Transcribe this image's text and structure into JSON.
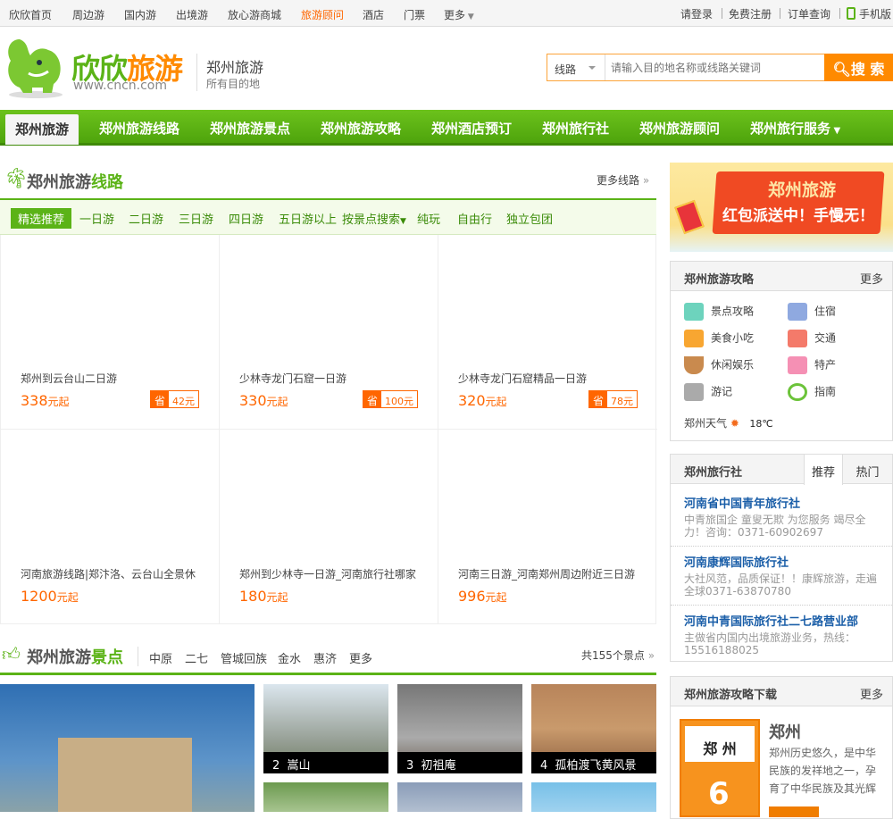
{
  "topbar": {
    "links": [
      "欣欣首页",
      "周边游",
      "国内游",
      "出境游",
      "放心游商城",
      "旅游顾问",
      "酒店",
      "门票",
      "更多"
    ],
    "active_color": "#ff6600",
    "right": [
      "请登录",
      "免费注册",
      "订单查询",
      "手机版"
    ]
  },
  "header": {
    "brand_a": "欣欣",
    "brand_b": "旅游",
    "domain": "www.cncn.com",
    "city": "郑州旅游",
    "slogan": "所有目的地"
  },
  "search": {
    "type": "线路",
    "placeholder": "请输入目的地名称或线路关键词",
    "button": "搜 索"
  },
  "nav": {
    "items": [
      "郑州旅游",
      "郑州旅游线路",
      "郑州旅游景点",
      "郑州旅游攻略",
      "郑州酒店预订",
      "郑州旅行社",
      "郑州旅游顾问",
      "郑州旅行服务"
    ],
    "accent": "#5bb317"
  },
  "routes": {
    "title_a": "郑州旅游",
    "title_b": "线路",
    "more": "更多线路",
    "tabs": [
      "精选推荐",
      "一日游",
      "二日游",
      "三日游",
      "四日游",
      "五日游以上",
      "按景点搜索",
      "纯玩",
      "自由行",
      "独立包团"
    ],
    "items": [
      {
        "title": "郑州到云台山二日游",
        "price": "338",
        "unit": "元起",
        "save_label": "省",
        "save": "42元"
      },
      {
        "title": "少林寺龙门石窟一日游",
        "price": "330",
        "unit": "元起",
        "save_label": "省",
        "save": "100元"
      },
      {
        "title": "少林寺龙门石窟精品一日游",
        "price": "320",
        "unit": "元起",
        "save_label": "省",
        "save": "78元"
      },
      {
        "title": "河南旅游线路|郑汴洛、云台山全景休",
        "price": "1200",
        "unit": "元起"
      },
      {
        "title": "郑州到少林寺一日游_河南旅行社哪家",
        "price": "180",
        "unit": "元起"
      },
      {
        "title": "河南三日游_河南郑州周边附近三日游",
        "price": "996",
        "unit": "元起"
      }
    ]
  },
  "spots": {
    "title_a": "郑州旅游",
    "title_b": "景点",
    "links": [
      "中原",
      "二七",
      "管城回族",
      "金水",
      "惠济",
      "更多"
    ],
    "count": "共155个景点",
    "items": [
      {
        "rank": "2",
        "name": "嵩山"
      },
      {
        "rank": "3",
        "name": "初祖庵"
      },
      {
        "rank": "4",
        "name": "孤柏渡飞黄风景区"
      }
    ]
  },
  "banner": {
    "title": "郑州旅游",
    "text": "红包派送中！手慢无！"
  },
  "guide": {
    "title": "郑州旅游攻略",
    "more": "更多",
    "items": [
      {
        "label": "景点攻略",
        "icon": "mountain-icon",
        "color": "#6dd3bd"
      },
      {
        "label": "住宿",
        "icon": "bed-icon",
        "color": "#8fa9e0"
      },
      {
        "label": "美食小吃",
        "icon": "fork-knife-icon",
        "color": "#f8a631"
      },
      {
        "label": "交通",
        "icon": "car-icon",
        "color": "#f47a6a"
      },
      {
        "label": "休闲娱乐",
        "icon": "coffee-icon",
        "color": "#c98a4e"
      },
      {
        "label": "特产",
        "icon": "gift-icon",
        "color": "#f590b4"
      },
      {
        "label": "游记",
        "icon": "camera-icon",
        "color": "#aaaaaa"
      },
      {
        "label": "指南",
        "icon": "compass-icon",
        "color": "#6cc33a"
      }
    ],
    "weather_label": "郑州天气",
    "temp": "18℃"
  },
  "agency": {
    "title": "郑州旅行社",
    "tabs": [
      "推荐",
      "热门"
    ],
    "items": [
      {
        "name": "河南省中国青年旅行社",
        "desc": "中青旅国企 童叟无欺 为您服务 竭尽全力！咨询：0371-60902697"
      },
      {
        "name": "河南康辉国际旅行社",
        "desc": "大社风范，品质保证！！康辉旅游，走遍全球0371-63870780"
      },
      {
        "name": "河南中青国际旅行社二七路营业部",
        "desc": "主做省内国内出境旅游业务，热线：15516188025"
      }
    ]
  },
  "download": {
    "title": "郑州旅游攻略下载",
    "more": "更多",
    "book_title": "郑 州",
    "book_num": "6",
    "name": "郑州",
    "desc": "郑州历史悠久，是中华民族的发祥地之一，孕育了中华民族及其光辉"
  }
}
